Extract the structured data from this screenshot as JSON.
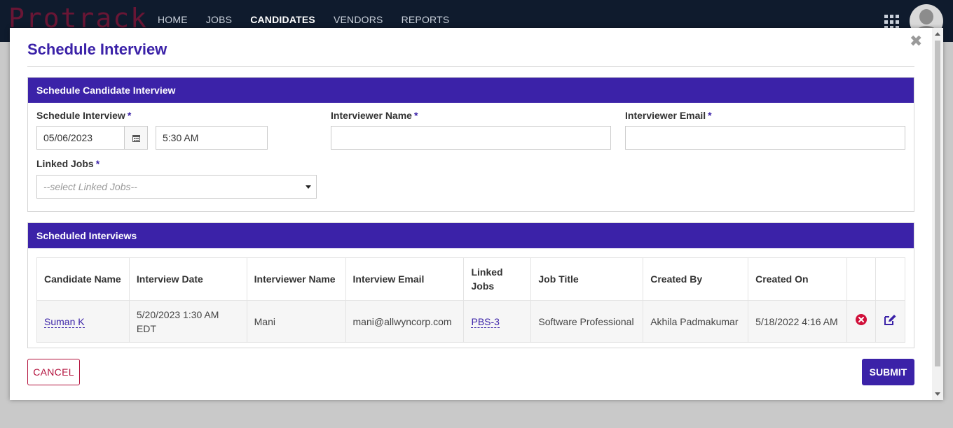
{
  "app": {
    "logo_text": "Protrack",
    "nav": [
      {
        "label": "HOME",
        "active": false
      },
      {
        "label": "JOBS",
        "active": false
      },
      {
        "label": "CANDIDATES",
        "active": true
      },
      {
        "label": "VENDORS",
        "active": false
      },
      {
        "label": "REPORTS",
        "active": false
      }
    ]
  },
  "modal": {
    "title": "Schedule Interview",
    "close_glyph": "✖",
    "schedule_panel": {
      "heading": "Schedule Candidate Interview",
      "schedule_label": "Schedule Interview",
      "date_value": "05/06/2023",
      "time_value": "5:30 AM",
      "interviewer_name_label": "Interviewer Name",
      "interviewer_name_value": "",
      "interviewer_email_label": "Interviewer Email",
      "interviewer_email_value": "",
      "linked_jobs_label": "Linked Jobs",
      "linked_jobs_placeholder": "--select Linked Jobs--",
      "required_mark": "*"
    },
    "scheduled_panel": {
      "heading": "Scheduled Interviews",
      "columns": [
        "Candidate Name",
        "Interview Date",
        "Interviewer Name",
        "Interview Email",
        "Linked Jobs",
        "Job Title",
        "Created By",
        "Created On",
        "",
        ""
      ],
      "rows": [
        {
          "candidate": "Suman K",
          "interview_date": "5/20/2023 1:30 AM EDT",
          "interviewer": "Mani",
          "email": "mani@allwyncorp.com",
          "linked_jobs": "PBS-3",
          "job_title": "Software Professional",
          "created_by": "Akhila Padmakumar",
          "created_on": "5/18/2022 4:16 AM"
        }
      ]
    },
    "buttons": {
      "cancel": "CANCEL",
      "submit": "SUBMIT"
    }
  },
  "colors": {
    "accent": "#3b22a8",
    "danger": "#b3123d",
    "nav_bg": "#0f1b2d",
    "delete_icon": "#d0103a"
  }
}
